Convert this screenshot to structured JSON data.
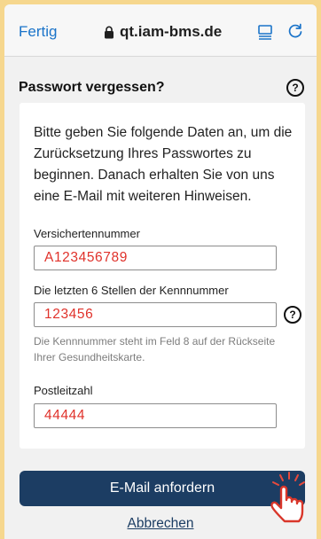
{
  "browser": {
    "done_label": "Fertig",
    "url": "qt.iam-bms.de",
    "icons": [
      "lock-icon",
      "reader-mode-icon",
      "reload-icon"
    ]
  },
  "page": {
    "title": "Passwort vergessen?",
    "intro": "Bitte geben Sie folgende Daten an, um die Zurücksetzung Ihres Passwortes zu beginnen. Danach erhalten Sie von uns eine E-Mail mit weiteren Hinweisen.",
    "fields": {
      "insurance": {
        "label": "Versichertennummer",
        "value": "A123456789"
      },
      "id_digits": {
        "label": "Die letzten 6 Stellen der Kennnummer",
        "value": "123456"
      },
      "zip": {
        "label": "Postleitzahl",
        "value": "44444"
      }
    },
    "id_hint": "Die Kennnummer steht im Feld 8 auf der Rückseite Ihrer Gesundheitskarte.",
    "help_glyph": "?",
    "submit_label": "E-Mail anfordern",
    "cancel_label": "Abbrechen"
  },
  "colors": {
    "accent": "#1c3d63",
    "link": "#1a73c9",
    "value_text": "#e0322b",
    "outer_background": "#f6d78e",
    "page_background": "#f1f1f1"
  }
}
